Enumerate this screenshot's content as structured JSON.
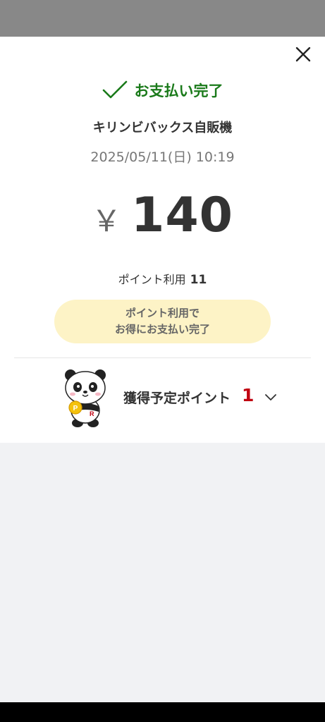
{
  "payment_complete": "お支払い完了",
  "merchant": "キリンビバックス自販機",
  "datetime": "2025/05/11(日) 10:19",
  "currency": "￥",
  "amount": "140",
  "points_used": {
    "label": "ポイント利用",
    "value": "11"
  },
  "promo": {
    "line1": "ポイント利用で",
    "line2": "お得にお支払い完了"
  },
  "earned": {
    "label": "獲得予定ポイント",
    "value": "1"
  },
  "colors": {
    "success": "#1a7a1a",
    "points_red": "#c00010",
    "promo_bg": "#fdf3c6"
  },
  "icons": [
    "close-icon",
    "check-icon",
    "panda-mascot",
    "chevron-down-icon"
  ]
}
